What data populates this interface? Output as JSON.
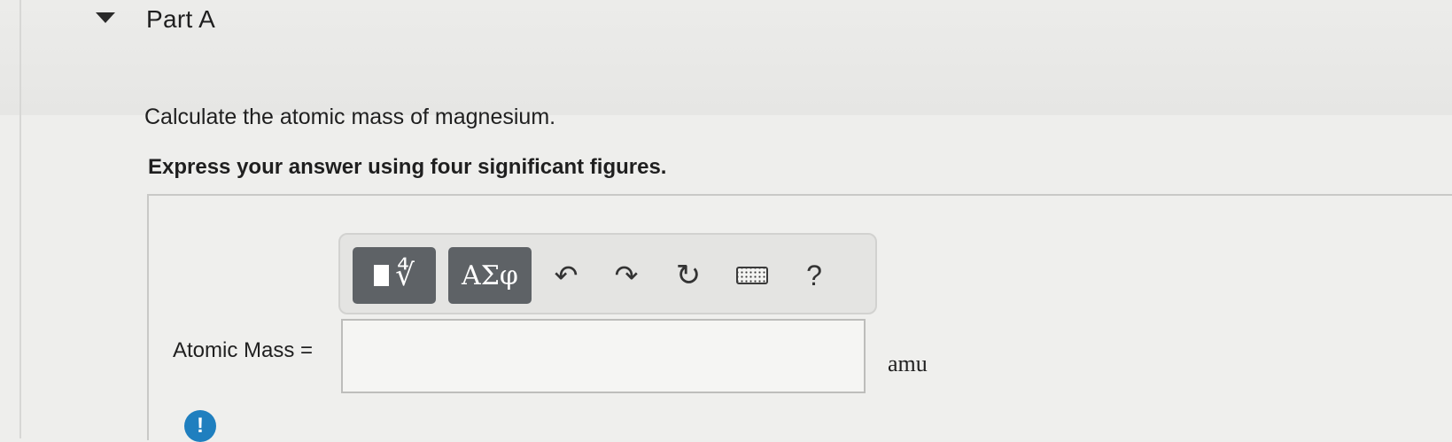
{
  "part": {
    "title": "Part A"
  },
  "problem": {
    "question": "Calculate the atomic mass of magnesium.",
    "instruction": "Express your answer using four significant figures."
  },
  "toolbar": {
    "templates_icon": "templates-radical-icon",
    "symbols_label": "ΑΣφ",
    "undo_icon": "undo-icon",
    "redo_icon": "redo-icon",
    "reset_icon": "reset-icon",
    "keyboard_icon": "keyboard-icon",
    "help_label": "?"
  },
  "answer": {
    "label": "Atomic Mass =",
    "value": "",
    "unit": "amu"
  },
  "alert": {
    "symbol": "!",
    "color": "#1f7fbf"
  }
}
